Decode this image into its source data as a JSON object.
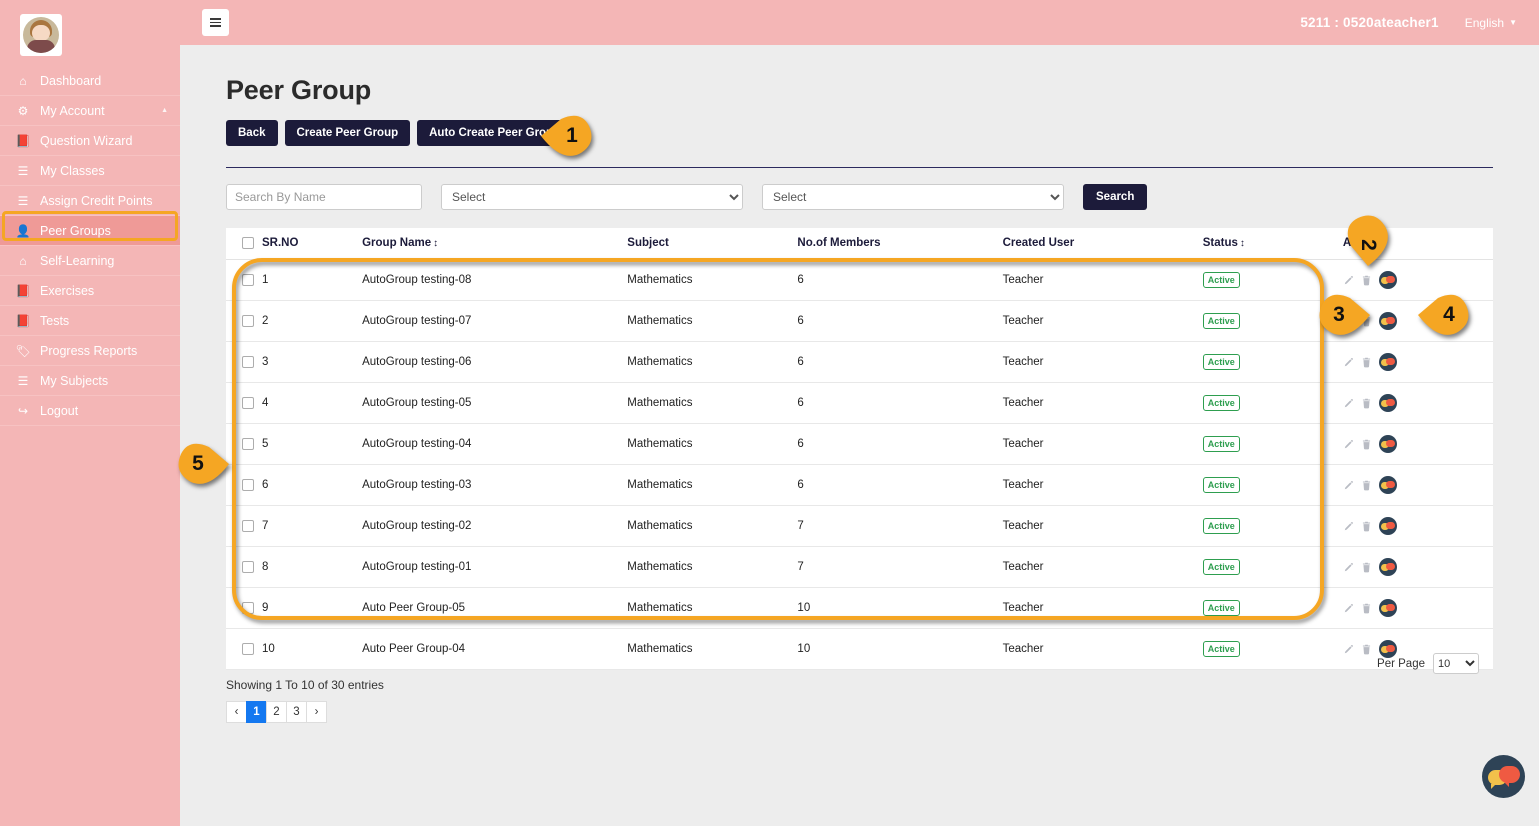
{
  "sidebar": {
    "avatar_name": "user-avatar",
    "items": [
      {
        "label": "Dashboard",
        "icon": "home-icon",
        "key": "dashboard",
        "active": false,
        "caret": false
      },
      {
        "label": "My Account",
        "icon": "gears-icon",
        "key": "my-account",
        "active": false,
        "caret": true
      },
      {
        "label": "Question Wizard",
        "icon": "book-icon",
        "key": "question-wizard",
        "active": false,
        "caret": false
      },
      {
        "label": "My Classes",
        "icon": "list-icon",
        "key": "my-classes",
        "active": false,
        "caret": false
      },
      {
        "label": "Assign Credit Points",
        "icon": "list-icon",
        "key": "assign-credit-points",
        "active": false,
        "caret": false
      },
      {
        "label": "Peer Groups",
        "icon": "user-icon",
        "key": "peer-groups",
        "active": true,
        "caret": false
      },
      {
        "label": "Self-Learning",
        "icon": "home-icon",
        "key": "self-learning",
        "active": false,
        "caret": false
      },
      {
        "label": "Exercises",
        "icon": "book-icon",
        "key": "exercises",
        "active": false,
        "caret": false
      },
      {
        "label": "Tests",
        "icon": "book-icon",
        "key": "tests",
        "active": false,
        "caret": false
      },
      {
        "label": "Progress Reports",
        "icon": "tag-icon",
        "key": "progress-reports",
        "active": false,
        "caret": false
      },
      {
        "label": "My Subjects",
        "icon": "list-icon",
        "key": "my-subjects",
        "active": false,
        "caret": false
      },
      {
        "label": "Logout",
        "icon": "logout-icon",
        "key": "logout",
        "active": false,
        "caret": false
      }
    ]
  },
  "topbar": {
    "menu_toggle": "hamburger-icon",
    "user": "5211 : 0520ateacher1",
    "language": "English"
  },
  "page": {
    "title": "Peer Group",
    "buttons": [
      {
        "label": "Back",
        "key": "back"
      },
      {
        "label": "Create Peer Group",
        "key": "create-peer-group"
      },
      {
        "label": "Auto Create Peer Group",
        "key": "auto-create-peer-group"
      }
    ]
  },
  "filters": {
    "search_placeholder": "Search By Name",
    "search_value": "",
    "select1": "Select",
    "select2": "Select",
    "search_button": "Search"
  },
  "table": {
    "columns": [
      {
        "label": "",
        "key": "select-all",
        "sortable": false
      },
      {
        "label": "SR.NO",
        "key": "sr-no",
        "sortable": false
      },
      {
        "label": "Group Name",
        "key": "group-name",
        "sortable": true
      },
      {
        "label": "Subject",
        "key": "subject",
        "sortable": false
      },
      {
        "label": "No.of Members",
        "key": "no-of-members",
        "sortable": false
      },
      {
        "label": "Created User",
        "key": "created-user",
        "sortable": false
      },
      {
        "label": "Status",
        "key": "status",
        "sortable": true
      },
      {
        "label": "Action",
        "key": "action",
        "sortable": false
      }
    ],
    "rows": [
      {
        "sr": "1",
        "name": "AutoGroup testing-08",
        "subject": "Mathematics",
        "members": "6",
        "user": "Teacher",
        "status": "Active"
      },
      {
        "sr": "2",
        "name": "AutoGroup testing-07",
        "subject": "Mathematics",
        "members": "6",
        "user": "Teacher",
        "status": "Active"
      },
      {
        "sr": "3",
        "name": "AutoGroup testing-06",
        "subject": "Mathematics",
        "members": "6",
        "user": "Teacher",
        "status": "Active"
      },
      {
        "sr": "4",
        "name": "AutoGroup testing-05",
        "subject": "Mathematics",
        "members": "6",
        "user": "Teacher",
        "status": "Active"
      },
      {
        "sr": "5",
        "name": "AutoGroup testing-04",
        "subject": "Mathematics",
        "members": "6",
        "user": "Teacher",
        "status": "Active"
      },
      {
        "sr": "6",
        "name": "AutoGroup testing-03",
        "subject": "Mathematics",
        "members": "6",
        "user": "Teacher",
        "status": "Active"
      },
      {
        "sr": "7",
        "name": "AutoGroup testing-02",
        "subject": "Mathematics",
        "members": "7",
        "user": "Teacher",
        "status": "Active"
      },
      {
        "sr": "8",
        "name": "AutoGroup testing-01",
        "subject": "Mathematics",
        "members": "7",
        "user": "Teacher",
        "status": "Active"
      },
      {
        "sr": "9",
        "name": "Auto Peer Group-05",
        "subject": "Mathematics",
        "members": "10",
        "user": "Teacher",
        "status": "Active"
      },
      {
        "sr": "10",
        "name": "Auto Peer Group-04",
        "subject": "Mathematics",
        "members": "10",
        "user": "Teacher",
        "status": "Active"
      }
    ],
    "row_actions": [
      {
        "key": "edit-icon",
        "title": "Edit"
      },
      {
        "key": "trash-icon",
        "title": "Delete"
      },
      {
        "key": "chat-icon",
        "title": "Chat"
      }
    ]
  },
  "footer": {
    "showing": "Showing 1 To 10 of 30 entries",
    "pages": [
      {
        "label": "‹",
        "key": "prev",
        "active": false
      },
      {
        "label": "1",
        "key": "page-1",
        "active": true
      },
      {
        "label": "2",
        "key": "page-2",
        "active": false
      },
      {
        "label": "3",
        "key": "page-3",
        "active": false
      },
      {
        "label": "›",
        "key": "next",
        "active": false
      }
    ],
    "per_page_label": "Per Page",
    "per_page_value": "10"
  },
  "fab": {
    "icon": "chat-bubbles-icon"
  },
  "annotations": {
    "markers": [
      {
        "id": "1",
        "target": "auto-create-peer-group-button"
      },
      {
        "id": "2",
        "target": "action-column-header"
      },
      {
        "id": "3",
        "target": "delete-icon"
      },
      {
        "id": "4",
        "target": "chat-icon"
      },
      {
        "id": "5",
        "target": "results-table"
      }
    ],
    "highlight_color": "#f5a623"
  }
}
